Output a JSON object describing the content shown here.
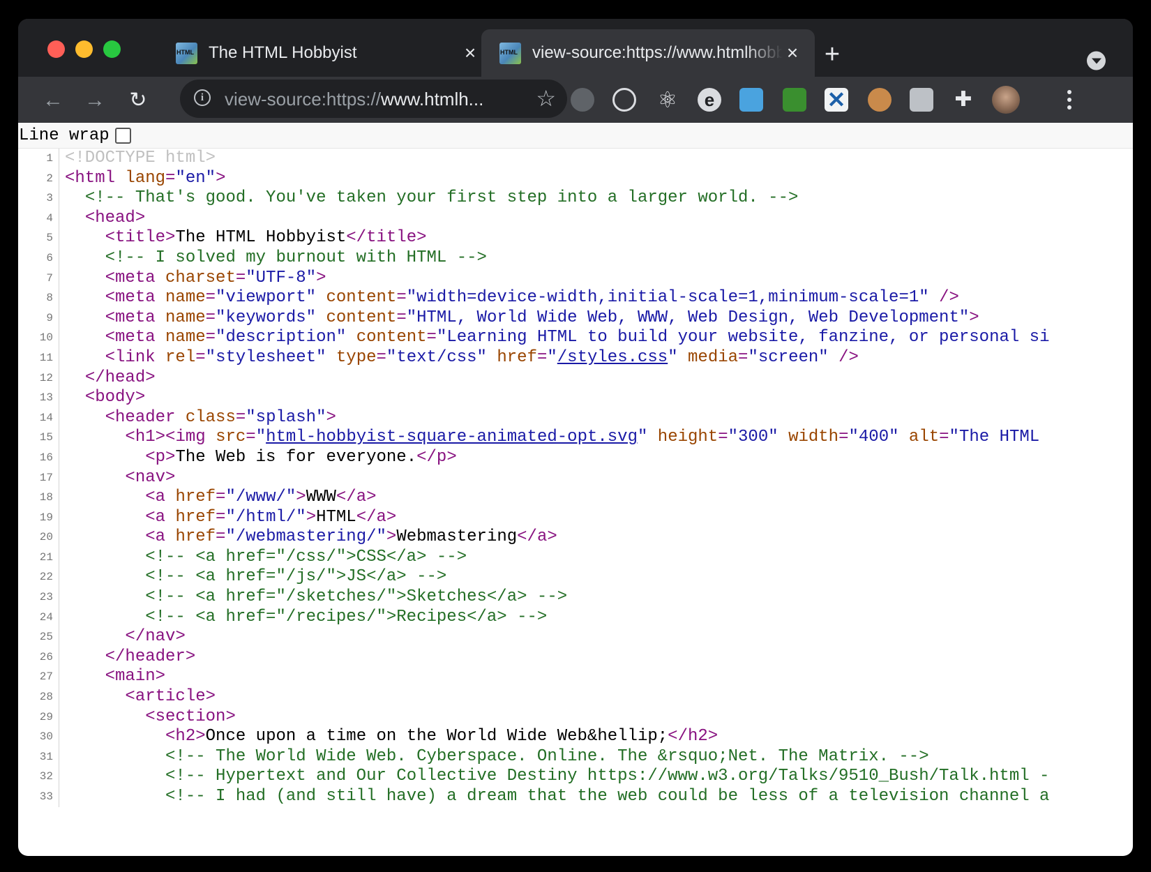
{
  "window": {
    "tabs": [
      {
        "title": "The HTML Hobbyist",
        "active": false
      },
      {
        "title": "view-source:https://www.htmlhobbyist.com/",
        "active": true
      }
    ],
    "new_tab": "+"
  },
  "toolbar": {
    "url_scheme": "view-source:https://",
    "url_host": "www.htmlh...",
    "extensions": [
      "tab-switcher-icon",
      "target-icon",
      "react-icon",
      "edge-icon",
      "window-icon",
      "chart-icon",
      "cross-icon",
      "cookie-icon",
      "camera-icon",
      "puzzle-icon",
      "profile-avatar"
    ]
  },
  "line_wrap_label": "Line wrap",
  "source_lines": [
    "<!DOCTYPE html>",
    "<html lang=\"en\">",
    "  <!-- That's good. You've taken your first step into a larger world. -->",
    "  <head>",
    "    <title>The HTML Hobbyist</title>",
    "    <!-- I solved my burnout with HTML -->",
    "    <meta charset=\"UTF-8\">",
    "    <meta name=\"viewport\" content=\"width=device-width,initial-scale=1,minimum-scale=1\" />",
    "    <meta name=\"keywords\" content=\"HTML, World Wide Web, WWW, Web Design, Web Development\">",
    "    <meta name=\"description\" content=\"Learning HTML to build your website, fanzine, or personal si",
    "    <link rel=\"stylesheet\" type=\"text/css\" href=\"/styles.css\" media=\"screen\" />",
    "  </head>",
    "  <body>",
    "    <header class=\"splash\">",
    "      <h1><img src=\"html-hobbyist-square-animated-opt.svg\" height=\"300\" width=\"400\" alt=\"The HTML",
    "        <p>The Web is for everyone.</p>",
    "      <nav>",
    "        <a href=\"/www/\">WWW</a>",
    "        <a href=\"/html/\">HTML</a>",
    "        <a href=\"/webmastering/\">Webmastering</a>",
    "        <!-- <a href=\"/css/\">CSS</a> -->",
    "        <!-- <a href=\"/js/\">JS</a> -->",
    "        <!-- <a href=\"/sketches/\">Sketches</a> -->",
    "        <!-- <a href=\"/recipes/\">Recipes</a> -->",
    "      </nav>",
    "    </header>",
    "    <main>",
    "      <article>",
    "        <section>",
    "          <h2>Once upon a time on the World Wide Web&hellip;</h2>",
    "          <!-- The World Wide Web. Cyberspace. Online. The &rsquo;Net. The Matrix. -->",
    "          <!-- Hypertext and Our Collective Destiny https://www.w3.org/Talks/9510_Bush/Talk.html -",
    "          <!-- I had (and still have) a dream that the web could be less of a television channel a"
  ]
}
